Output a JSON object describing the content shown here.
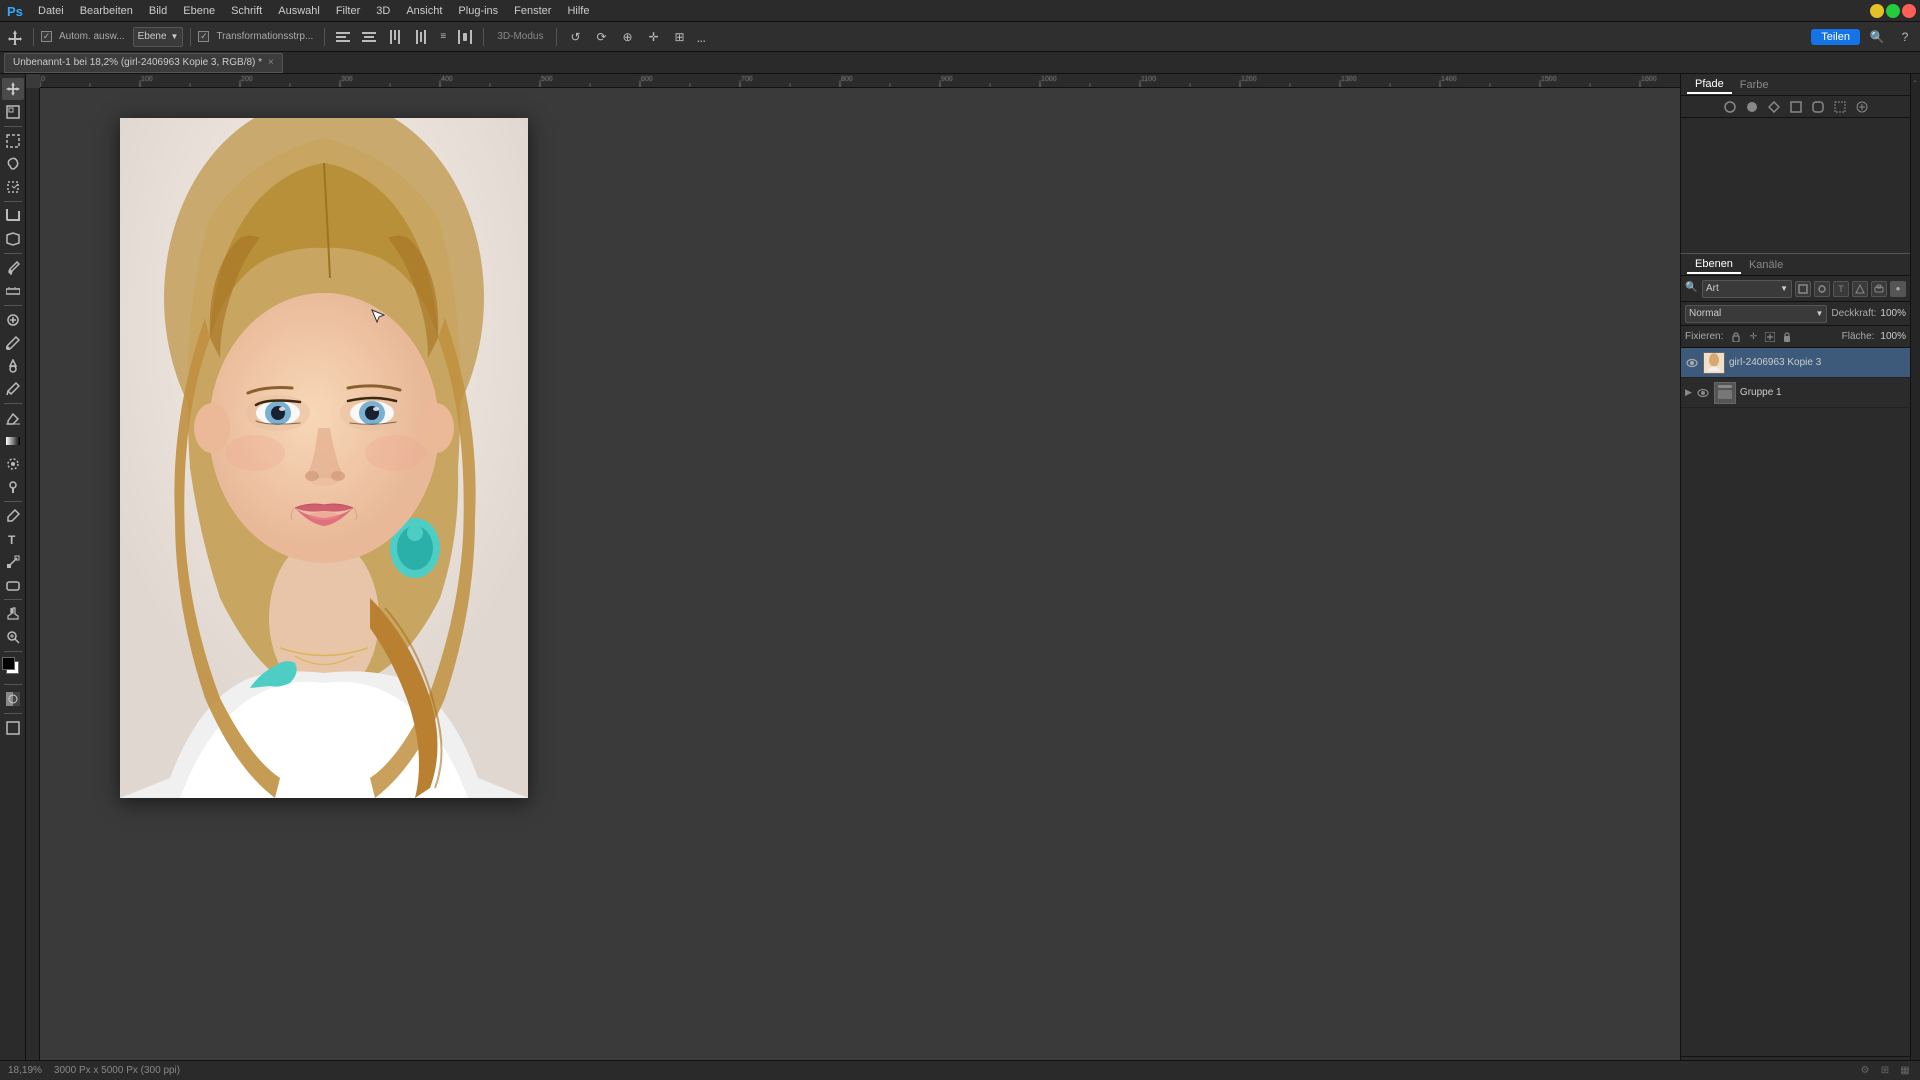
{
  "app": {
    "title": "Adobe Photoshop",
    "window_title": "Unbenannt-1 bei 18,2% (girl-2406963 Kopie 3, RGB/8) *"
  },
  "menu": {
    "items": [
      "Datei",
      "Bearbeiten",
      "Bild",
      "Ebene",
      "Schrift",
      "Auswahl",
      "Filter",
      "3D",
      "Ansicht",
      "Plug-ins",
      "Fenster",
      "Hilfe"
    ]
  },
  "toolbar": {
    "auto_label": "Autom. ausw...",
    "ebene_label": "Ebene",
    "transformation_label": "Transformationsstrp...",
    "three_d_label": "3D-Modus",
    "dots_label": "...",
    "share_label": "Teilen"
  },
  "tab": {
    "title": "Unbenannt-1 bei 18,2% (girl-2406963 Kopie 3, RGB/8) *"
  },
  "right_panel": {
    "tabs": [
      "Pfade",
      "Farbe"
    ],
    "layers_tab": "Ebenen",
    "kanale_tab": "Kanäle",
    "filter_type": "Art",
    "blend_mode": "Normal",
    "opacity_label": "Deckkraft:",
    "opacity_value": "100%",
    "fixieren_label": "Fixieren:",
    "flaeche_label": "Fläche:",
    "flaeche_value": "100%",
    "layers": [
      {
        "name": "girl-2406963 Kopie 3",
        "visible": true,
        "active": true,
        "type": "image"
      },
      {
        "name": "Gruppe 1",
        "visible": true,
        "active": false,
        "type": "group"
      }
    ]
  },
  "status_bar": {
    "zoom": "18,19%",
    "dimensions": "3000 Px x 5000 Px (300 ppi)"
  },
  "tools": [
    "move",
    "select-rect",
    "select-lasso",
    "select-object",
    "crop",
    "eyedropper",
    "healing-brush",
    "brush",
    "clone-stamp",
    "history-brush",
    "eraser",
    "gradient",
    "blur",
    "dodge",
    "pen",
    "text",
    "path-select",
    "shape",
    "hand",
    "zoom",
    "foreground-color",
    "background-color",
    "quick-mask",
    "screen-mode"
  ]
}
